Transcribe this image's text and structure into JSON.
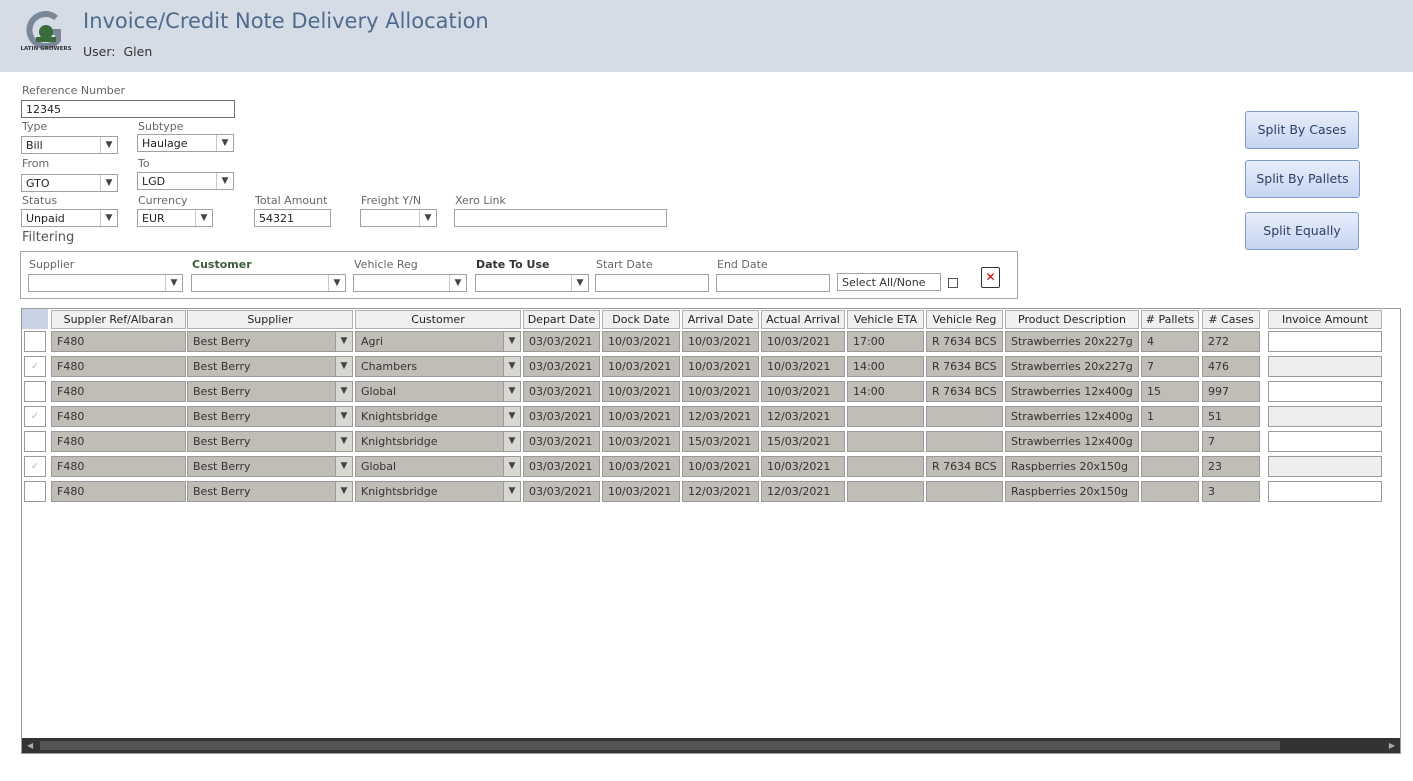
{
  "header": {
    "logo_text": "LATIN GROWERS",
    "title": "Invoice/Credit Note Delivery Allocation",
    "user_label": "User:",
    "user_name": "Glen"
  },
  "form": {
    "reference_label": "Reference Number",
    "reference_value": "12345",
    "type_label": "Type",
    "type_value": "Bill",
    "subtype_label": "Subtype",
    "subtype_value": "Haulage",
    "from_label": "From",
    "from_value": "GTO",
    "to_label": "To",
    "to_value": "LGD",
    "status_label": "Status",
    "status_value": "Unpaid",
    "currency_label": "Currency",
    "currency_value": "EUR",
    "total_label": "Total Amount",
    "total_value": "54321",
    "freight_label": "Freight Y/N",
    "freight_value": "",
    "xero_label": "Xero Link",
    "xero_value": ""
  },
  "filtering": {
    "title": "Filtering",
    "supplier_label": "Supplier",
    "customer_label": "Customer",
    "vehicle_label": "Vehicle Reg",
    "date_to_use_label": "Date To Use",
    "start_label": "Start Date",
    "end_label": "End Date",
    "select_all_label": "Select All/None"
  },
  "buttons": {
    "split_cases": "Split By Cases",
    "split_pallets": "Split By Pallets",
    "split_equally": "Split Equally"
  },
  "table": {
    "columns": [
      "Suppler Ref/Albaran",
      "Supplier",
      "Customer",
      "Depart Date",
      "Dock Date",
      "Arrival Date",
      "Actual Arrival",
      "Vehicle ETA",
      "Vehicle Reg",
      "Product Description",
      "# Pallets",
      "# Cases",
      "Invoice Amount"
    ],
    "rows": [
      {
        "checked": false,
        "ref": "F480",
        "supplier": "Best Berry",
        "customer": "Agri",
        "depart": "03/03/2021",
        "dock": "10/03/2021",
        "arrival": "10/03/2021",
        "actual": "10/03/2021",
        "eta": "17:00",
        "reg": "R 7634 BCS",
        "product": "Strawberries 20x227g",
        "pallets": "4",
        "cases": "272",
        "amount": ""
      },
      {
        "checked": true,
        "ref": "F480",
        "supplier": "Best Berry",
        "customer": "Chambers",
        "depart": "03/03/2021",
        "dock": "10/03/2021",
        "arrival": "10/03/2021",
        "actual": "10/03/2021",
        "eta": "14:00",
        "reg": "R 7634 BCS",
        "product": "Strawberries 20x227g",
        "pallets": "7",
        "cases": "476",
        "amount": ""
      },
      {
        "checked": false,
        "ref": "F480",
        "supplier": "Best Berry",
        "customer": "Global",
        "depart": "03/03/2021",
        "dock": "10/03/2021",
        "arrival": "10/03/2021",
        "actual": "10/03/2021",
        "eta": "14:00",
        "reg": "R 7634 BCS",
        "product": "Strawberries 12x400g",
        "pallets": "15",
        "cases": "997",
        "amount": ""
      },
      {
        "checked": true,
        "ref": "F480",
        "supplier": "Best Berry",
        "customer": "Knightsbridge",
        "depart": "03/03/2021",
        "dock": "10/03/2021",
        "arrival": "12/03/2021",
        "actual": "12/03/2021",
        "eta": "",
        "reg": "",
        "product": "Strawberries 12x400g",
        "pallets": "1",
        "cases": "51",
        "amount": ""
      },
      {
        "checked": false,
        "ref": "F480",
        "supplier": "Best Berry",
        "customer": "Knightsbridge",
        "depart": "03/03/2021",
        "dock": "10/03/2021",
        "arrival": "15/03/2021",
        "actual": "15/03/2021",
        "eta": "",
        "reg": "",
        "product": "Strawberries 12x400g",
        "pallets": "",
        "cases": "7",
        "amount": ""
      },
      {
        "checked": true,
        "ref": "F480",
        "supplier": "Best Berry",
        "customer": "Global",
        "depart": "03/03/2021",
        "dock": "10/03/2021",
        "arrival": "10/03/2021",
        "actual": "10/03/2021",
        "eta": "",
        "reg": "R 7634 BCS",
        "product": "Raspberries 20x150g",
        "pallets": "",
        "cases": "23",
        "amount": ""
      },
      {
        "checked": false,
        "ref": "F480",
        "supplier": "Best Berry",
        "customer": "Knightsbridge",
        "depart": "03/03/2021",
        "dock": "10/03/2021",
        "arrival": "12/03/2021",
        "actual": "12/03/2021",
        "eta": "",
        "reg": "",
        "product": "Raspberries 20x150g",
        "pallets": "",
        "cases": "3",
        "amount": ""
      }
    ]
  }
}
